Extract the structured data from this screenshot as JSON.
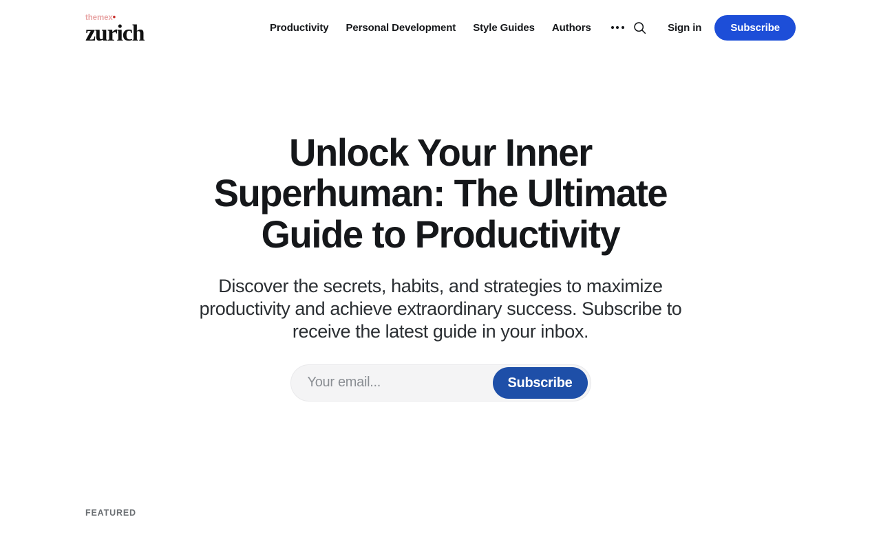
{
  "brand": {
    "top_text": "themex",
    "top_dot": "•",
    "name": "zurich"
  },
  "header": {
    "nav_items": [
      {
        "label": "Productivity"
      },
      {
        "label": "Personal Development"
      },
      {
        "label": "Style Guides"
      },
      {
        "label": "Authors"
      }
    ],
    "more_menu_name": "more-menu",
    "search_icon": "search-icon",
    "signin_label": "Sign in",
    "subscribe_label": "Subscribe",
    "subscribe_color": "#1d4ed8"
  },
  "hero": {
    "title": "Unlock Your Inner Superhuman: The Ultimate Guide to Productivity",
    "subtitle": "Discover the secrets, habits, and strategies to maximize productivity and achieve extraordinary success. Subscribe to receive the latest guide in your inbox.",
    "form": {
      "email_placeholder": "Your email...",
      "email_value": "",
      "submit_label": "Subscribe",
      "submit_color": "#1e4fa8",
      "field_background": "#f4f4f5"
    }
  },
  "featured": {
    "label": "FEATURED"
  },
  "colors": {
    "text": "#15171a",
    "muted": "#6b6f73",
    "brand_pink": "#e8a5a5",
    "brand_dot": "#c9302c",
    "accent_blue": "#1d4ed8",
    "background": "#ffffff"
  }
}
